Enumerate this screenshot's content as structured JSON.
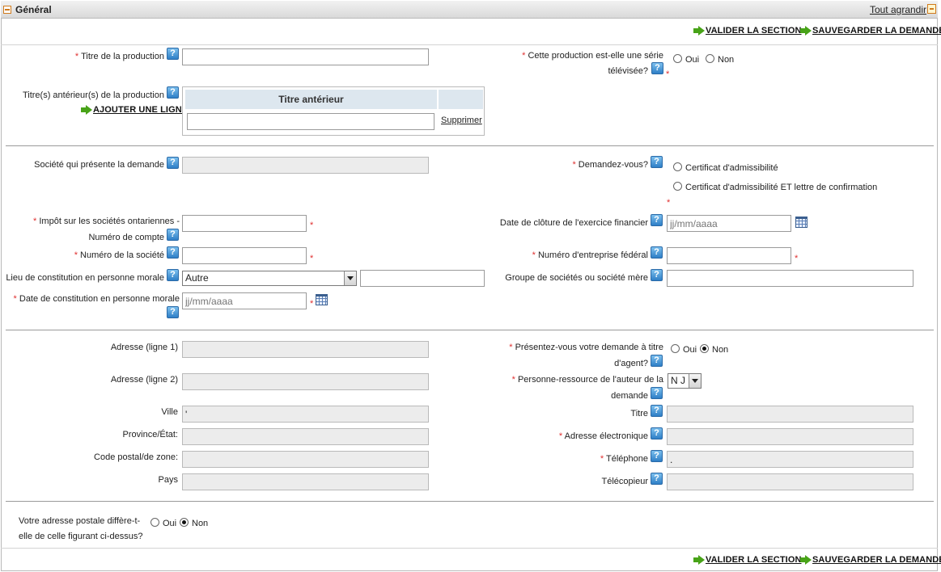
{
  "header": {
    "title": "Général",
    "expand_all": "Tout agrandir"
  },
  "actions": {
    "validate": "VALIDER LA SECTION",
    "save": "SAUVEGARDER LA DEMANDE"
  },
  "production": {
    "title_label": "Titre de la production",
    "series_label_1": "Cette production est-elle une série",
    "series_label_2": "télévisée?",
    "yes": "Oui",
    "no": "Non",
    "previous_titles_label": "Titre(s) antérieur(s) de la production",
    "add_row": "AJOUTER UNE LIGNE",
    "table_header": "Titre antérieur",
    "delete": "Supprimer"
  },
  "company": {
    "applicant_label": "Société qui présente la demande",
    "request_label": "Demandez-vous?",
    "option_certificate": "Certificat d'admissibilité",
    "option_certificate_letter": "Certificat d'admissibilité ET lettre de confirmation",
    "tax_label_1": "Impôt sur les sociétés ontariennes -",
    "tax_label_2": "Numéro de compte",
    "fiscal_end_label": "Date de clôture de l'exercice financier",
    "date_placeholder": "jj/mm/aaaa",
    "company_number_label": "Numéro de la société",
    "federal_number_label": "Numéro d'entreprise fédéral",
    "incorporation_place_label": "Lieu de constitution en personne morale",
    "incorporation_place_value": "Autre",
    "group_label": "Groupe de sociétés ou société mère",
    "incorporation_date_label": "Date de constitution en personne morale"
  },
  "address": {
    "line1_label": "Adresse (ligne 1)",
    "line2_label": "Adresse (ligne 2)",
    "city_label": "Ville",
    "city_value": "'",
    "province_label": "Province/État:",
    "postal_label": "Code postal/de zone:",
    "country_label": "Pays",
    "agent_label_1": "Présentez-vous votre demande à titre",
    "agent_label_2": "d'agent?",
    "contact_label_1": "Personne-ressource de l'auteur de la",
    "contact_label_2": "demande",
    "contact_value": "N J",
    "title_label": "Titre",
    "email_label": "Adresse électronique",
    "phone_label": "Téléphone",
    "phone_value": ".",
    "fax_label": "Télécopieur",
    "yes": "Oui",
    "no": "Non"
  },
  "postal": {
    "question_1": "Votre adresse postale diffère-t-",
    "question_2": "elle de celle figurant ci-dessus?",
    "yes": "Oui",
    "no": "Non"
  },
  "colors": {
    "required": "#e03030",
    "help_icon": "#2e7fc6",
    "action_arrow": "#48a318",
    "collapse_icon": "#d07a1c"
  }
}
